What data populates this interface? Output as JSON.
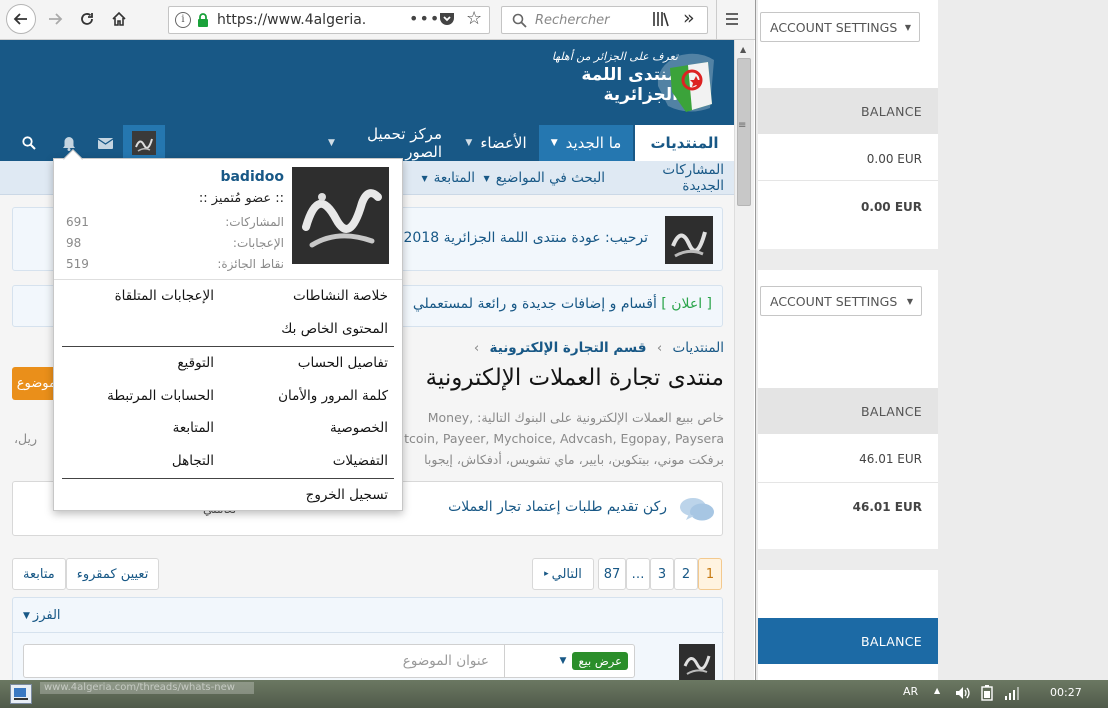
{
  "browser": {
    "url": "https://www.4algeria.com",
    "search_placeholder": "Rechercher"
  },
  "site": {
    "logo_line1": "تعرف على الجزائر من أهلها",
    "logo_line2": "منتدى اللمة الجزائرية",
    "nav_tabs": [
      "المنتديات",
      "ما الجديد",
      "الأعضاء",
      "مركز تحميل الصور"
    ],
    "subnav": [
      "المشاركات الجديدة",
      "البحث في المواضيع",
      "المتابعة"
    ],
    "welcome_notice": "ترحيب: عودة منتدى اللمة الجزائرية 2018",
    "announcement_tag": "[ اعلان ]",
    "announcement_text": "أقسام و إضافات جديدة و رائعة لمستعملي",
    "breadcrumb": [
      "المنتديات",
      "قسم التجارة الإلكترونية"
    ],
    "page_title": "منتدى تجارة العملات الإلكترونية",
    "description_line1": "خاص ببيع العملات الإلكترونية على البنوك التالية: ,Money",
    "description_line2": "Bitcoin, Payeer, Mychoice, Advcash, Egopay, Paysera,",
    "description_line3": "برفكت موني، بيتكوين، بايير، ماي تشويس، أدفكاش، إيجوبا",
    "description_side": "ريل،",
    "orange_button": "موضوع",
    "sticky_forum": "ركن تقديم طلبات إعتماد تجار العملات",
    "sticky_side": "تعاملي",
    "pagination": {
      "current": "1",
      "pages": [
        "1",
        "2",
        "3",
        "…",
        "87"
      ],
      "next_label": "التالي"
    },
    "mark_read_label": "تعيين كمقروء",
    "watch_label": "متابعة",
    "filter_label": "الفرز",
    "thread_prefix": "عرض بيع",
    "thread_title_placeholder": "عنوان الموضوع"
  },
  "user_menu": {
    "username": "badidoo",
    "rank": ":: عضو مُتميز ::",
    "stats": [
      {
        "label": "المشاركات:",
        "value": "691"
      },
      {
        "label": "الإعجابات:",
        "value": "98"
      },
      {
        "label": "نقاط الجائزة:",
        "value": "519"
      }
    ],
    "links_right": [
      "خلاصة النشاطات",
      "المحتوى الخاص بك"
    ],
    "links_left": [
      "الإعجابات المتلقاة"
    ],
    "account_right": [
      "تفاصيل الحساب",
      "كلمة المرور والأمان",
      "الخصوصية",
      "التفضيلات"
    ],
    "account_left": [
      "التوقيع",
      "الحسابات المرتبطة",
      "المتابعة",
      "التجاهل"
    ],
    "logout": "تسجيل الخروج"
  },
  "right_panel": {
    "account_settings_label": "ACCOUNT SETTINGS",
    "balance_label": "BALANCE",
    "block1": {
      "row1": "0.00 EUR",
      "row2": "0.00 EUR"
    },
    "block2": {
      "row1": "46.01 EUR",
      "row2": "46.01 EUR"
    },
    "accent_color": "#1c6aa5"
  },
  "taskbar": {
    "language": "AR",
    "clock": "00:27",
    "status_url": "www.4algeria.com/threads/whats-new"
  }
}
